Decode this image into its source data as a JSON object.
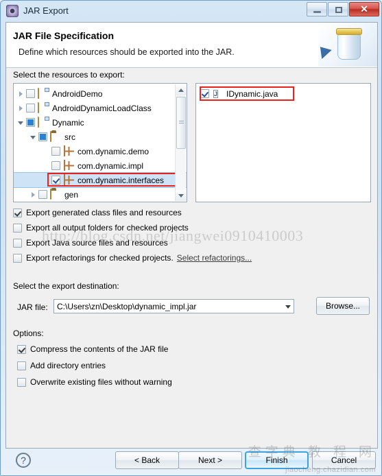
{
  "window": {
    "title": "JAR Export",
    "icon": "jar-export-icon",
    "buttons": {
      "minimize": "minimize",
      "maximize": "maximize",
      "close": "✕"
    }
  },
  "header": {
    "title": "JAR File Specification",
    "subtitle": "Define which resources should be exported into the JAR.",
    "graphic": "jar-jar-icon"
  },
  "resources": {
    "label": "Select the resources to export:",
    "tree": [
      {
        "label": "AndroidDemo",
        "indent": 0,
        "twisty": "closed",
        "check": "unchecked",
        "icon": "java-project-icon",
        "selected": false,
        "highlight": false
      },
      {
        "label": "AndroidDynamicLoadClass",
        "indent": 0,
        "twisty": "closed",
        "check": "unchecked",
        "icon": "java-project-icon",
        "selected": false,
        "highlight": false
      },
      {
        "label": "Dynamic",
        "indent": 0,
        "twisty": "open",
        "check": "full",
        "icon": "java-project-icon",
        "selected": false,
        "highlight": false
      },
      {
        "label": "src",
        "indent": 1,
        "twisty": "open",
        "check": "full",
        "icon": "source-folder-icon",
        "selected": false,
        "highlight": false
      },
      {
        "label": "com.dynamic.demo",
        "indent": 2,
        "twisty": "none",
        "check": "unchecked",
        "icon": "package-icon",
        "selected": false,
        "highlight": false
      },
      {
        "label": "com.dynamic.impl",
        "indent": 2,
        "twisty": "none",
        "check": "unchecked",
        "icon": "package-icon",
        "selected": false,
        "highlight": false
      },
      {
        "label": "com.dynamic.interfaces",
        "indent": 2,
        "twisty": "none",
        "check": "checked",
        "icon": "package-icon",
        "selected": true,
        "highlight": true
      },
      {
        "label": "gen",
        "indent": 1,
        "twisty": "closed",
        "check": "unchecked",
        "icon": "source-folder-icon",
        "selected": false,
        "highlight": false
      }
    ],
    "files": [
      {
        "label": "IDynamic.java",
        "check": "checked",
        "icon": "java-file-icon",
        "glyph": "J",
        "highlight": true
      }
    ]
  },
  "options_top": [
    {
      "label": "Export generated class files and resources",
      "checked": true,
      "link": ""
    },
    {
      "label": "Export all output folders for checked projects",
      "checked": false,
      "link": ""
    },
    {
      "label": "Export Java source files and resources",
      "checked": false,
      "link": ""
    },
    {
      "label": "Export refactorings for checked projects.",
      "checked": false,
      "link": "Select refactorings..."
    }
  ],
  "destination": {
    "label": "Select the export destination:",
    "field_label": "JAR file:",
    "value": "C:\\Users\\zn\\Desktop\\dynamic_impl.jar",
    "browse_label": "Browse..."
  },
  "options": {
    "label": "Options:",
    "items": [
      {
        "label": "Compress the contents of the JAR file",
        "checked": true
      },
      {
        "label": "Add directory entries",
        "checked": false
      },
      {
        "label": "Overwrite existing files without warning",
        "checked": false
      }
    ]
  },
  "footer": {
    "help": "?",
    "back": "< Back",
    "next": "Next >",
    "finish": "Finish",
    "cancel": "Cancel"
  },
  "watermarks": {
    "url": "http://blog.csdn.net/jiangwei0910410003",
    "cn": "查字典 教 程 网",
    "site": "jiaocheng.chazidian.com"
  },
  "colors": {
    "accent": "#3ea2e0",
    "highlight": "#e8221c",
    "close_button": "#b92d22",
    "title_bg": "#cfe2f3"
  }
}
